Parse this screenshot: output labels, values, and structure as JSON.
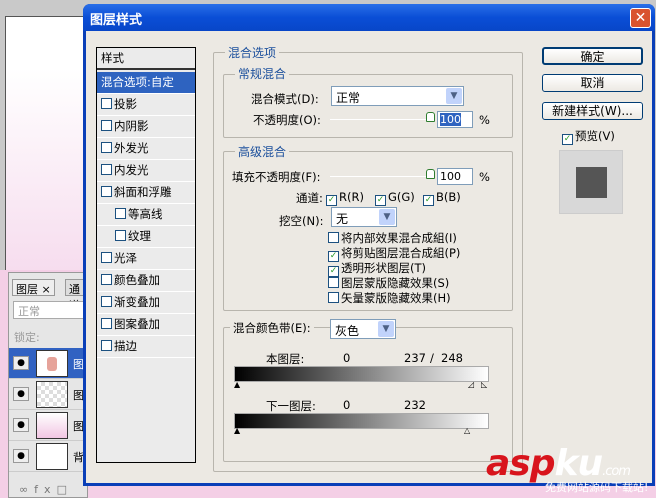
{
  "dialog": {
    "title": "图层样式",
    "close": "✕"
  },
  "styles": {
    "header": "样式",
    "items": [
      {
        "label": "混合选项:自定",
        "selected": true
      },
      {
        "label": "投影",
        "checked": false
      },
      {
        "label": "内阴影",
        "checked": false
      },
      {
        "label": "外发光",
        "checked": false
      },
      {
        "label": "内发光",
        "checked": false
      },
      {
        "label": "斜面和浮雕",
        "checked": false
      },
      {
        "label": "等高线",
        "checked": false
      },
      {
        "label": "纹理",
        "checked": false
      },
      {
        "label": "光泽",
        "checked": false
      },
      {
        "label": "颜色叠加",
        "checked": false
      },
      {
        "label": "渐变叠加",
        "checked": false
      },
      {
        "label": "图案叠加",
        "checked": false
      },
      {
        "label": "描边",
        "checked": false
      }
    ]
  },
  "blending": {
    "title": "混合选项",
    "general": {
      "title": "常规混合",
      "mode_label": "混合模式(D):",
      "mode_value": "正常",
      "opacity_label": "不透明度(O):",
      "opacity_value": "100",
      "percent": "%"
    },
    "advanced": {
      "title": "高级混合",
      "fill_label": "填充不透明度(F):",
      "fill_value": "100",
      "percent": "%",
      "channels_label": "通道:",
      "r": "R(R)",
      "g": "G(G)",
      "b": "B(B)",
      "knockout_label": "挖空(N):",
      "knockout_value": "无",
      "options": [
        {
          "label": "将内部效果混合成組(I)",
          "checked": false
        },
        {
          "label": "将剪贴图层混合成組(P)",
          "checked": true
        },
        {
          "label": "透明形状图层(T)",
          "checked": true
        },
        {
          "label": "图层蒙版隐藏效果(S)",
          "checked": false
        },
        {
          "label": "矢量蒙版隐藏效果(H)",
          "checked": false
        }
      ]
    },
    "blend_if": {
      "label": "混合颜色带(E):",
      "value": "灰色",
      "this_layer_label": "本图层:",
      "this_layer_black": "0",
      "this_layer_white_a": "237",
      "sep": "/",
      "this_layer_white_b": "248",
      "under_layer_label": "下一图层:",
      "under_layer_black": "0",
      "under_layer_white": "232"
    }
  },
  "buttons": {
    "ok": "确定",
    "cancel": "取消",
    "new_style": "新建样式(W)...",
    "preview": "预览(V)"
  },
  "layers_panel": {
    "tab_layers": "图层",
    "tab_close": "×",
    "tab_channels": "通道",
    "blend_mode": "正常",
    "lock_label": "锁定:",
    "layer_initial": "图",
    "bg_initial": "背"
  },
  "watermark": {
    "main": "asp",
    "accent": "ku",
    "suffix": ".com",
    "sub": "免费网站源码下载站!"
  },
  "colors": {
    "title_blue": "#0a4ed6",
    "selection": "#2e63c0",
    "accent_text": "#1b4f9c"
  }
}
